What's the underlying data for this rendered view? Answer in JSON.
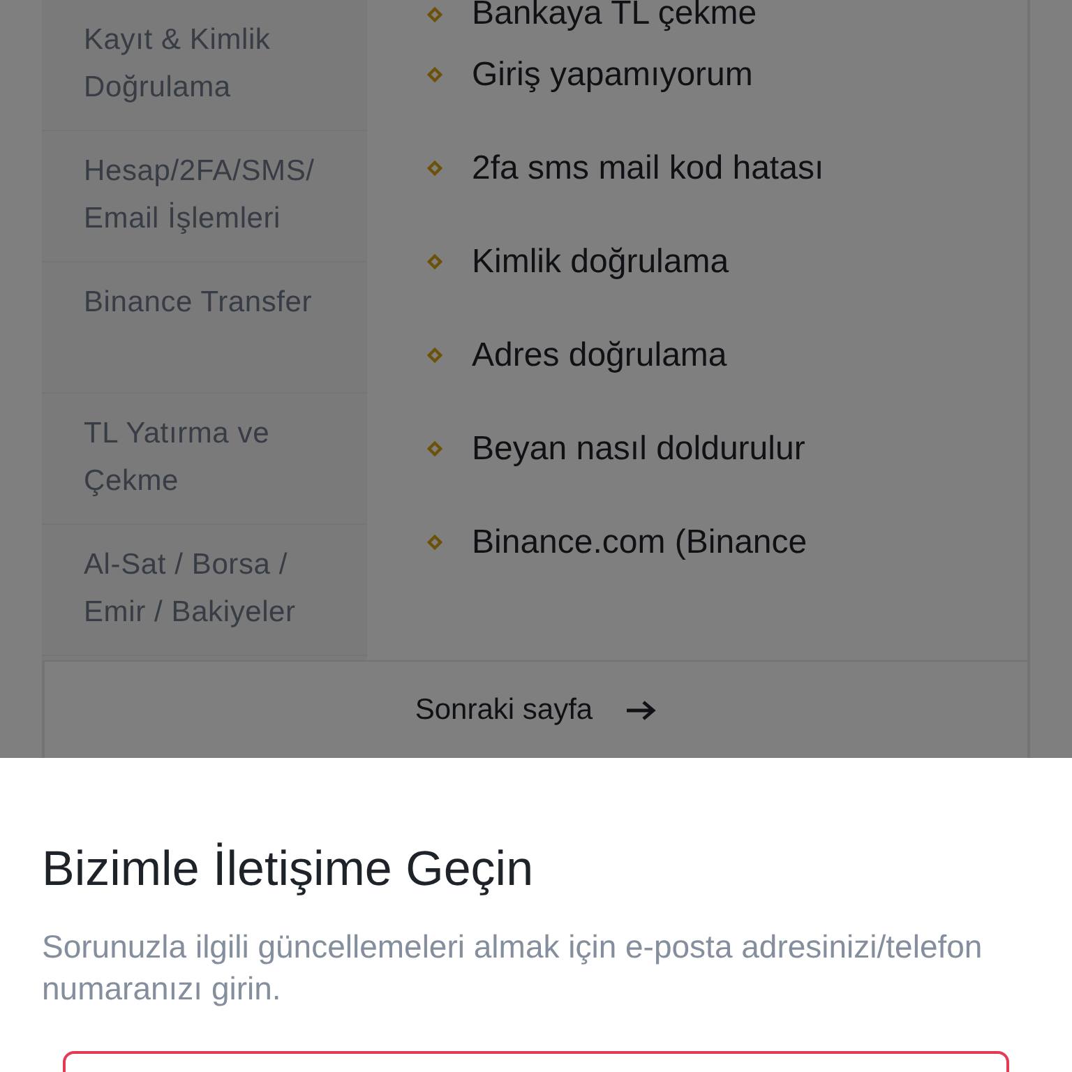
{
  "sidebar": {
    "items": [
      {
        "label": "Kayıt & Kimlik Doğrulama"
      },
      {
        "label": "Hesap/2FA/SMS/ Email İşlemleri"
      },
      {
        "label": "Binance Transfer"
      },
      {
        "label": "TL Yatırma ve Çekme"
      },
      {
        "label": "Al-Sat / Borsa / Emir / Bakiyeler"
      }
    ]
  },
  "links": [
    "Bankaya TL çekme",
    "Giriş yapamıyorum",
    "2fa sms mail kod hatası",
    "Kimlik doğrulama",
    "Adres doğrulama",
    "Beyan nasıl doldurulur",
    "Binance.com (Binance"
  ],
  "pagination": {
    "next": "Sonraki sayfa"
  },
  "modal": {
    "title": "Bizimle İletişime Geçin",
    "description": "Sorunuzla ilgili güncellemeleri almak için e-posta adresinizi/telefon numaranızı girin.",
    "field": {
      "error": true
    }
  }
}
